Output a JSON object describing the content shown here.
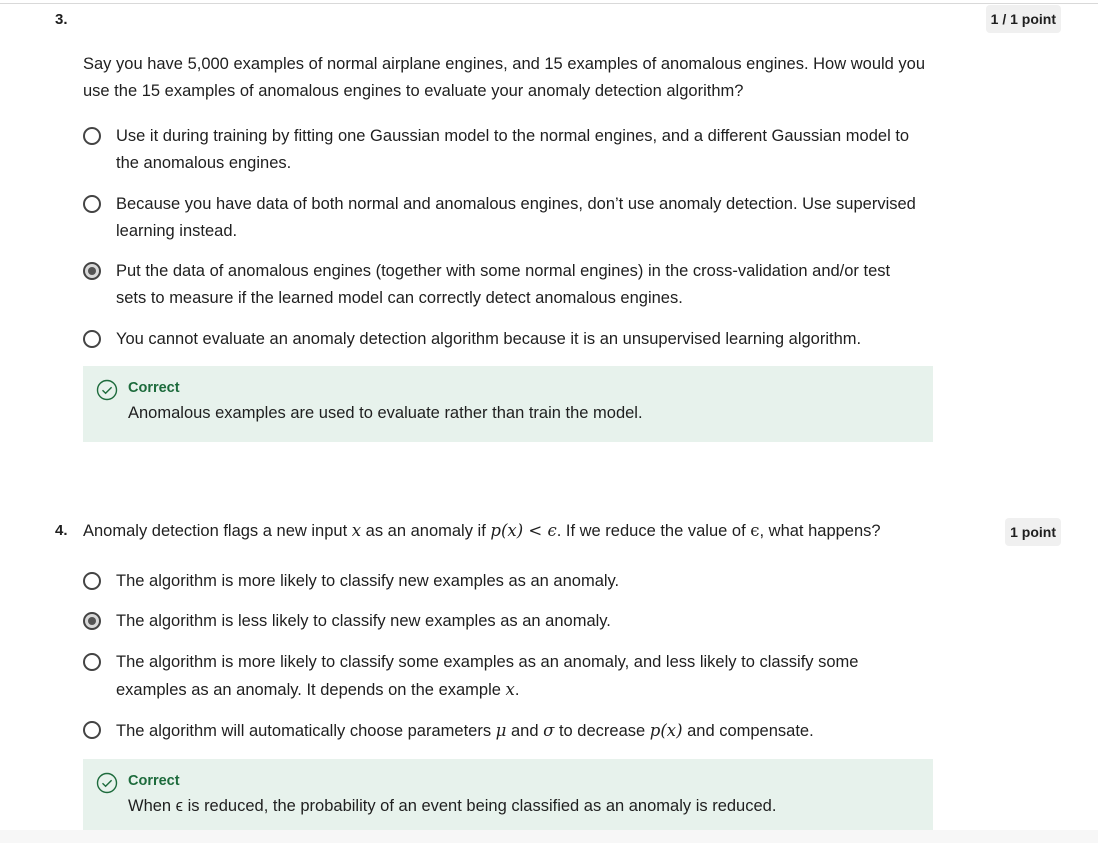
{
  "q3": {
    "number": "3.",
    "points": "1 / 1 point",
    "prompt": "Say you have 5,000 examples of normal airplane engines, and 15 examples of anomalous engines. How would you use the 15 examples of anomalous engines to evaluate your anomaly detection algorithm?",
    "options": [
      {
        "label": "Use it during training by fitting one Gaussian model to the normal engines, and a different Gaussian model to the anomalous engines.",
        "selected": false
      },
      {
        "label": "Because you have data of both normal and anomalous engines, don’t use anomaly detection. Use supervised learning instead.",
        "selected": false
      },
      {
        "label": "Put the data of anomalous engines (together with some normal engines) in the cross-validation and/or test sets to measure if the learned model can correctly detect anomalous engines.",
        "selected": true
      },
      {
        "label": "You cannot evaluate an anomaly detection algorithm because it is an unsupervised learning algorithm.",
        "selected": false
      }
    ],
    "feedback": {
      "status": "Correct",
      "text": "Anomalous examples are used to evaluate rather than train the model."
    }
  },
  "q4": {
    "number": "4.",
    "points": "1 point",
    "prompt_parts": {
      "p1": "Anomaly detection flags a new input ",
      "x": "x",
      "p2": " as an anomaly if ",
      "px": "p(x) < ϵ",
      "p3": ". If we reduce the value of ",
      "eps": "ϵ",
      "p4": ", what happens?"
    },
    "options": [
      {
        "label": "The algorithm is more likely to classify new examples as an anomaly.",
        "selected": false
      },
      {
        "label": "The algorithm is less likely to classify new examples as an anomaly.",
        "selected": true
      },
      {
        "label_a": "The algorithm is more likely to classify some examples as an anomaly, and less likely to classify some examples as an anomaly. It depends on the example ",
        "label_math": "x",
        "label_b": ".",
        "selected": false
      },
      {
        "label_a": "The algorithm will automatically choose parameters ",
        "mu": "μ",
        "label_and": " and ",
        "sigma": "σ",
        "label_mid": " to decrease ",
        "px": "p(x)",
        "label_b": " and compensate.",
        "selected": false
      }
    ],
    "feedback": {
      "status": "Correct",
      "text": "When ϵ is reduced, the probability of an event being classified as an anomaly is reduced."
    }
  },
  "colors": {
    "feedback_bg": "#e7f2ec",
    "feedback_accent": "#1d6b3c"
  },
  "icons": {
    "feedback": "check-circle-icon",
    "option": "radio-button"
  }
}
